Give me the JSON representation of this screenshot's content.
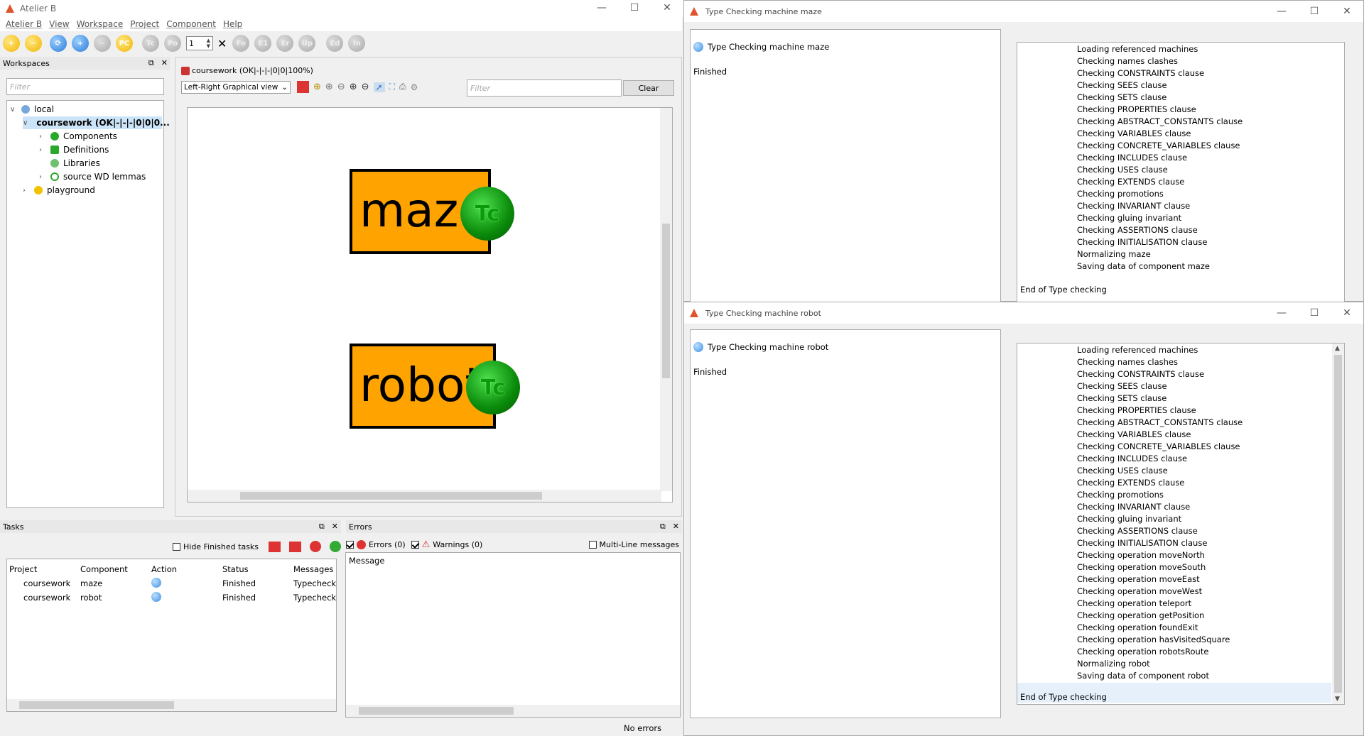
{
  "main_window": {
    "title": "Atelier B",
    "menu": [
      "Atelier B",
      "View",
      "Workspace",
      "Project",
      "Component",
      "Help"
    ],
    "toolbar": {
      "spin_value": "1",
      "buttons": [
        "new",
        "remove",
        "refresh",
        "add",
        "minus",
        "pc",
        "tc",
        "po",
        "fo",
        "e1",
        "er",
        "up",
        "ed",
        "in"
      ],
      "labels": {
        "pc": "PC",
        "tc": "Tc",
        "po": "Po",
        "fo": "Fo",
        "e1": "E1",
        "er": "Er",
        "up": "Up",
        "ed": "Ed",
        "in": "In"
      }
    }
  },
  "workspaces": {
    "title": "Workspaces",
    "filter_placeholder": "Filter",
    "tree": {
      "local": "local",
      "project": "coursework (OK|-|-|-|0|0|0...",
      "components": "Components",
      "definitions": "Definitions",
      "libraries": "Libraries",
      "lemmas": "source WD lemmas",
      "playground": "playground"
    }
  },
  "graph_view": {
    "tab_title": "coursework (OK|-|-|-|0|0|100%)",
    "view_mode": "Left-Right Graphical view",
    "filter_placeholder": "Filter",
    "clear_label": "Clear",
    "nodes": [
      {
        "label": "maze",
        "badge": "Tc"
      },
      {
        "label": "robot",
        "badge": "Tc"
      }
    ]
  },
  "tasks": {
    "title": "Tasks",
    "hide_finished": "Hide Finished tasks",
    "columns": [
      "Project",
      "Component",
      "Action",
      "Status",
      "Messages"
    ],
    "rows": [
      {
        "project": "coursework",
        "component": "maze",
        "status": "Finished",
        "message": "Typecheck"
      },
      {
        "project": "coursework",
        "component": "robot",
        "status": "Finished",
        "message": "Typecheck"
      }
    ]
  },
  "errors": {
    "title": "Errors",
    "errors_label": "Errors (0)",
    "warnings_label": "Warnings (0)",
    "multiline_label": "Multi-Line messages",
    "column": "Message",
    "status": "No errors"
  },
  "tc_maze": {
    "title": "Type Checking machine maze",
    "header": "Type Checking machine maze",
    "finished": "Finished",
    "log": [
      "Loading referenced machines",
      "Checking names clashes",
      "Checking CONSTRAINTS clause",
      "Checking SEES clause",
      "Checking SETS clause",
      "Checking PROPERTIES clause",
      "Checking ABSTRACT_CONSTANTS clause",
      "Checking VARIABLES clause",
      "Checking CONCRETE_VARIABLES clause",
      "Checking INCLUDES clause",
      "Checking USES clause",
      "Checking EXTENDS clause",
      "Checking promotions",
      "Checking INVARIANT clause",
      "Checking gluing invariant",
      "Checking ASSERTIONS clause",
      "Checking INITIALISATION clause",
      "Normalizing maze",
      "Saving data of component maze"
    ],
    "end": "End of Type checking"
  },
  "tc_robot": {
    "title": "Type Checking machine robot",
    "header": "Type Checking machine robot",
    "finished": "Finished",
    "log": [
      "Loading referenced machines",
      "Checking names clashes",
      "Checking CONSTRAINTS clause",
      "Checking SEES clause",
      "Checking SETS clause",
      "Checking PROPERTIES clause",
      "Checking ABSTRACT_CONSTANTS clause",
      "Checking VARIABLES clause",
      "Checking CONCRETE_VARIABLES clause",
      "Checking INCLUDES clause",
      "Checking USES clause",
      "Checking EXTENDS clause",
      "Checking promotions",
      "Checking INVARIANT clause",
      "Checking gluing invariant",
      "Checking ASSERTIONS clause",
      "Checking INITIALISATION clause",
      "Checking operation moveNorth",
      "Checking operation moveSouth",
      "Checking operation moveEast",
      "Checking operation moveWest",
      "Checking operation teleport",
      "Checking operation getPosition",
      "Checking operation foundExit",
      "Checking operation hasVisitedSquare",
      "Checking operation robotsRoute",
      "Normalizing robot",
      "Saving data of component robot"
    ],
    "end": "End of Type checking"
  }
}
